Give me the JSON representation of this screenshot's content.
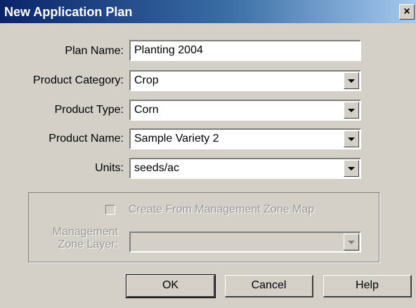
{
  "window": {
    "title": "New Application Plan",
    "close_glyph": "×"
  },
  "form": {
    "plan_name": {
      "label": "Plan Name:",
      "value": "Planting 2004"
    },
    "product_category": {
      "label": "Product Category:",
      "value": "Crop"
    },
    "product_type": {
      "label": "Product Type:",
      "value": "Corn"
    },
    "product_name": {
      "label": "Product Name:",
      "value": "Sample Variety 2"
    },
    "units": {
      "label": "Units:",
      "value": "seeds/ac"
    }
  },
  "zone_group": {
    "checkbox_label": "Create From Management Zone Map",
    "layer_label_line1": "Management",
    "layer_label_line2": "Zone Layer:",
    "layer_value": ""
  },
  "buttons": {
    "ok": "OK",
    "cancel": "Cancel",
    "help": "Help"
  },
  "icons": [
    "close-icon",
    "dropdown-arrow-icon",
    "checkbox-icon"
  ],
  "colors": {
    "titlebar_start": "#0a246a",
    "titlebar_end": "#a6caf0",
    "dialog_bg": "#d4d0c8",
    "disabled_text": "#9a9894"
  }
}
